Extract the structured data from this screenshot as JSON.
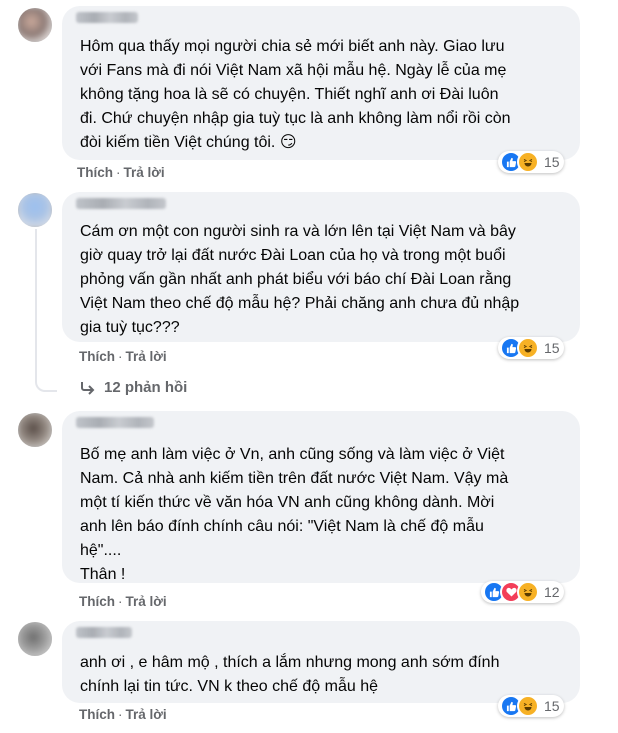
{
  "comments": [
    {
      "text": "Hôm qua thấy mọi người chia sẻ mới biết anh này. Giao lưu\nvới Fans mà đi nói Việt Nam xã hội mẫu hệ. Ngày lễ của mẹ\nkhông tặng hoa là sẽ có chuyện. Thiết nghĩ anh ơi Đài luôn\nđi. Chứ chuyện nhập gia tuỳ tục là anh không làm nổi rồi còn\nđòi kiếm tiền Việt chúng tôi. 😏",
      "like_label": "Thích",
      "reply_label": "Trả lời",
      "reaction_count": "15",
      "reaction_icons": [
        "like-icon",
        "haha-icon"
      ]
    },
    {
      "text": "Cám ơn một con người sinh ra và lớn lên tại Việt Nam và bây\ngiờ quay trở lại đất nước Đài Loan của họ và trong một buổi\nphỏng vấn gần nhất anh phát biểu với báo chí Đài Loan rằng\nViệt Nam theo chế độ mẫu hệ? Phải chăng anh chưa đủ nhập\ngia tuỳ tục???",
      "like_label": "Thích",
      "reply_label": "Trả lời",
      "reaction_count": "15",
      "reaction_icons": [
        "like-icon",
        "haha-icon"
      ],
      "replies_label": "12 phản hồi"
    },
    {
      "text": "Bố mẹ anh làm việc ở Vn, anh cũng sống và làm việc ở Việt\nNam. Cả nhà anh kiếm tiền trên đất nước Việt Nam. Vậy mà\nmột tí kiến thức về văn hóa VN anh cũng không dành. Mời\nanh lên báo đính chính câu nói: \"Việt Nam là chế độ mẫu\nhệ\"....\nThân !",
      "like_label": "Thích",
      "reply_label": "Trả lời",
      "reaction_count": "12",
      "reaction_icons": [
        "like-icon",
        "love-icon",
        "haha-icon"
      ]
    },
    {
      "text": "anh ơi , e hâm mộ , thích a lắm nhưng mong anh sớm đính\nchính lại tin tức. VN k theo chế độ mẫu hệ",
      "like_label": "Thích",
      "reply_label": "Trả lời",
      "reaction_count": "15",
      "reaction_icons": [
        "like-icon",
        "haha-icon"
      ]
    }
  ],
  "colors": {
    "bubble": "#f0f2f5",
    "like": "#1877f2",
    "love": "#f33e58",
    "haha": "#f7b125",
    "meta_text": "#65676b"
  }
}
